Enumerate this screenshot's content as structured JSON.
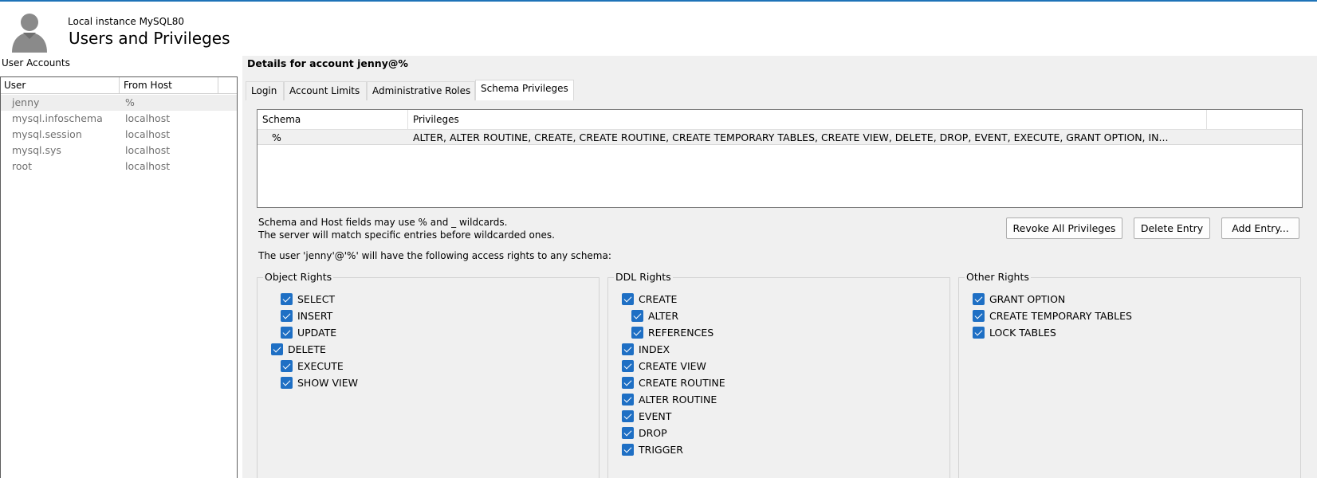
{
  "header": {
    "instance": "Local instance MySQL80",
    "title": "Users and Privileges"
  },
  "accounts": {
    "label": "User Accounts",
    "columns": [
      "User",
      "From Host"
    ],
    "rows": [
      {
        "user": "jenny",
        "host": "%"
      },
      {
        "user": "mysql.infoschema",
        "host": "localhost"
      },
      {
        "user": "mysql.session",
        "host": "localhost"
      },
      {
        "user": "mysql.sys",
        "host": "localhost"
      },
      {
        "user": "root",
        "host": "localhost"
      }
    ]
  },
  "details": {
    "title": "Details for account jenny@%",
    "tabs": [
      "Login",
      "Account Limits",
      "Administrative Roles",
      "Schema Privileges"
    ],
    "active_tab": "Schema Privileges"
  },
  "schema": {
    "columns": [
      "Schema",
      "Privileges"
    ],
    "rows": [
      {
        "schema": "%",
        "privileges": "ALTER, ALTER ROUTINE, CREATE, CREATE ROUTINE, CREATE TEMPORARY TABLES, CREATE VIEW, DELETE, DROP, EVENT, EXECUTE, GRANT OPTION, IN..."
      }
    ],
    "hint_line1": "Schema and Host fields may use % and _ wildcards.",
    "hint_line2": "The server will match specific entries before wildcarded ones.",
    "access_text": "The user 'jenny'@'%' will have the following access rights to any schema:"
  },
  "buttons": {
    "revoke": "Revoke All Privileges",
    "delete": "Delete Entry",
    "add": "Add Entry..."
  },
  "rights": {
    "object": {
      "label": "Object Rights",
      "items": [
        "SELECT",
        "INSERT",
        "UPDATE",
        "DELETE",
        "EXECUTE",
        "SHOW VIEW"
      ]
    },
    "ddl": {
      "label": "DDL Rights",
      "items": [
        "CREATE",
        "ALTER",
        "REFERENCES",
        "INDEX",
        "CREATE VIEW",
        "CREATE ROUTINE",
        "ALTER ROUTINE",
        "EVENT",
        "DROP",
        "TRIGGER"
      ]
    },
    "other": {
      "label": "Other Rights",
      "items": [
        "GRANT OPTION",
        "CREATE TEMPORARY TABLES",
        "LOCK TABLES"
      ]
    }
  },
  "colors": {
    "accent": "#1e73b8",
    "checkbox": "#1e6fc4",
    "panel_bg": "#f0f0f0"
  },
  "icons": {
    "avatar": "user-silhouette-icon",
    "checkbox": "checkmark-icon"
  }
}
